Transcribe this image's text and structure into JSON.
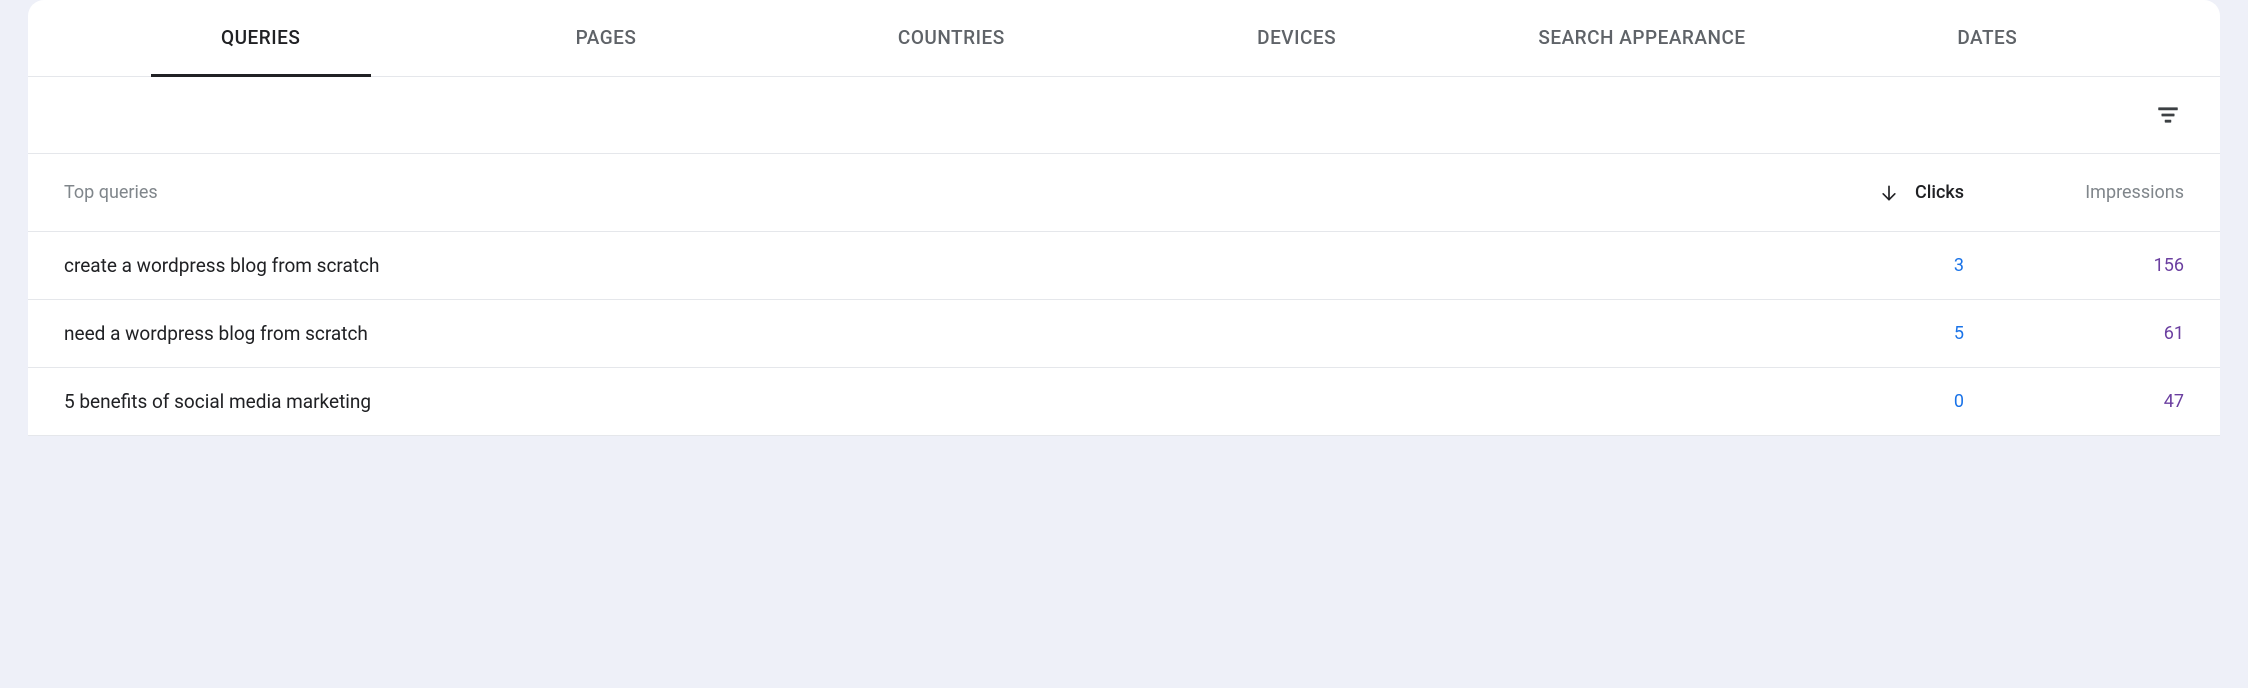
{
  "tabs": [
    {
      "label": "QUERIES",
      "active": true
    },
    {
      "label": "PAGES",
      "active": false
    },
    {
      "label": "COUNTRIES",
      "active": false
    },
    {
      "label": "DEVICES",
      "active": false
    },
    {
      "label": "SEARCH APPEARANCE",
      "active": false
    },
    {
      "label": "DATES",
      "active": false
    }
  ],
  "table": {
    "headers": {
      "queries": "Top queries",
      "clicks": "Clicks",
      "impressions": "Impressions"
    },
    "rows": [
      {
        "query": "create a wordpress blog from scratch",
        "clicks": "3",
        "impressions": "156"
      },
      {
        "query": "need a wordpress blog from scratch",
        "clicks": "5",
        "impressions": "61"
      },
      {
        "query": "5 benefits of social media marketing",
        "clicks": "0",
        "impressions": "47"
      }
    ]
  }
}
